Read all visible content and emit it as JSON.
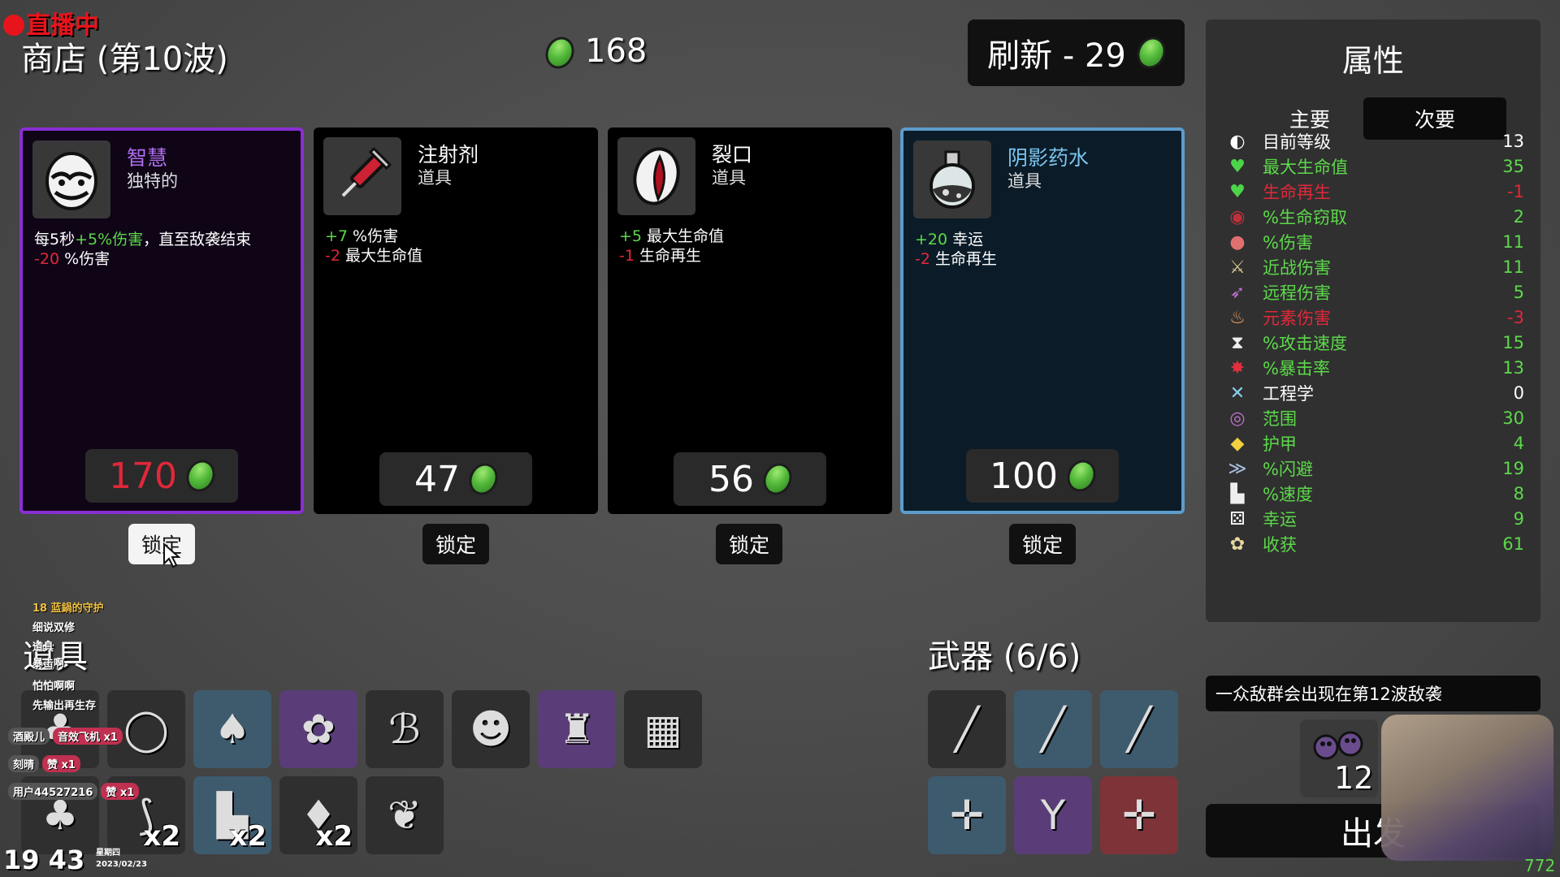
{
  "overlay": {
    "live_label": "直播中"
  },
  "header": {
    "title": "商店 (第10波)",
    "gold": "168",
    "reroll_label": "刷新 - 29"
  },
  "cards": [
    {
      "name": "智慧",
      "type": "独特的",
      "price": "170",
      "lock": "锁定",
      "effects": [
        [
          {
            "t": "每5秒",
            "c": "w"
          },
          {
            "t": "+5%伤害",
            "c": "pos"
          },
          {
            "t": "，直至敌袭结束",
            "c": "w"
          }
        ],
        [
          {
            "t": "-20",
            "c": "neg"
          },
          {
            "t": " %伤害",
            "c": "w"
          }
        ]
      ]
    },
    {
      "name": "注射剂",
      "type": "道具",
      "price": "47",
      "lock": "锁定",
      "effects": [
        [
          {
            "t": "+7",
            "c": "pos"
          },
          {
            "t": " %伤害",
            "c": "w"
          }
        ],
        [
          {
            "t": "-2",
            "c": "neg"
          },
          {
            "t": " 最大生命值",
            "c": "w"
          }
        ]
      ]
    },
    {
      "name": "裂口",
      "type": "道具",
      "price": "56",
      "lock": "锁定",
      "effects": [
        [
          {
            "t": "+5",
            "c": "pos"
          },
          {
            "t": " 最大生命值",
            "c": "w"
          }
        ],
        [
          {
            "t": "-1",
            "c": "neg"
          },
          {
            "t": " 生命再生",
            "c": "w"
          }
        ]
      ]
    },
    {
      "name": "阴影药水",
      "type": "道具",
      "price": "100",
      "lock": "锁定",
      "effects": [
        [
          {
            "t": "+20",
            "c": "pos"
          },
          {
            "t": " 幸运",
            "c": "w"
          }
        ],
        [
          {
            "t": "-2",
            "c": "neg"
          },
          {
            "t": " 生命再生",
            "c": "w"
          }
        ]
      ]
    }
  ],
  "stats": {
    "title": "属性",
    "tab_main": "主要",
    "tab_secondary": "次要",
    "rows": [
      {
        "label": "目前等级",
        "value": "13",
        "c": "w",
        "icon": "level-up-icon"
      },
      {
        "label": "最大生命值",
        "value": "35",
        "c": "g",
        "icon": "heart-icon"
      },
      {
        "label": "生命再生",
        "value": "-1",
        "c": "r",
        "icon": "heart-plus-icon"
      },
      {
        "label": "%生命窃取",
        "value": "2",
        "c": "g",
        "icon": "teeth-icon"
      },
      {
        "label": "%伤害",
        "value": "11",
        "c": "g",
        "icon": "muscle-icon"
      },
      {
        "label": "近战伤害",
        "value": "11",
        "c": "g",
        "icon": "sword-icon"
      },
      {
        "label": "远程伤害",
        "value": "5",
        "c": "g",
        "icon": "bow-icon"
      },
      {
        "label": "元素伤害",
        "value": "-3",
        "c": "r",
        "icon": "flame-icon"
      },
      {
        "label": "%攻击速度",
        "value": "15",
        "c": "g",
        "icon": "hourglass-icon"
      },
      {
        "label": "%暴击率",
        "value": "13",
        "c": "g",
        "icon": "crit-burst-icon"
      },
      {
        "label": "工程学",
        "value": "0",
        "c": "w",
        "icon": "wrench-cross-icon"
      },
      {
        "label": "范围",
        "value": "30",
        "c": "g",
        "icon": "range-icon"
      },
      {
        "label": "护甲",
        "value": "4",
        "c": "g",
        "icon": "shield-icon"
      },
      {
        "label": "%闪避",
        "value": "19",
        "c": "g",
        "icon": "dodge-icon"
      },
      {
        "label": "%速度",
        "value": "8",
        "c": "g",
        "icon": "boot-icon"
      },
      {
        "label": "幸运",
        "value": "9",
        "c": "g",
        "icon": "dice-icon"
      },
      {
        "label": "收获",
        "value": "61",
        "c": "g",
        "icon": "wheat-icon"
      }
    ]
  },
  "inventory": {
    "items_heading": "道具",
    "weapons_heading": "武器 (6/6)",
    "items": [
      {
        "icon": "tree-icon",
        "bg": "",
        "count": ""
      },
      {
        "icon": "egg-mask-icon",
        "bg": "",
        "count": ""
      },
      {
        "icon": "garden-bed-icon",
        "bg": "blu",
        "count": ""
      },
      {
        "icon": "wheat-icon",
        "bg": "pur",
        "count": ""
      },
      {
        "icon": "butterfly-icon",
        "bg": "",
        "count": ""
      },
      {
        "icon": "scarecrow-face-icon",
        "bg": "",
        "count": ""
      },
      {
        "icon": "fire-extinguisher-icon",
        "bg": "pur",
        "count": ""
      },
      {
        "icon": "flannel-shirt-icon",
        "bg": "",
        "count": ""
      },
      {
        "icon": "tree-icon",
        "bg": "",
        "count": ""
      },
      {
        "icon": "crooked-stick-icon",
        "bg": "",
        "count": "x2"
      },
      {
        "icon": "boot-icon",
        "bg": "blu",
        "count": "x2"
      },
      {
        "icon": "seed-bag-icon",
        "bg": "",
        "count": "x2"
      },
      {
        "icon": "fertilizer-bag-icon",
        "bg": "",
        "count": ""
      }
    ],
    "weapons": [
      {
        "icon": "spear-icon",
        "bg": ""
      },
      {
        "icon": "spear-icon",
        "bg": "blu"
      },
      {
        "icon": "spear-icon",
        "bg": "blu"
      },
      {
        "icon": "crossbow-icon",
        "bg": "blu"
      },
      {
        "icon": "slingshot-icon",
        "bg": "pur"
      },
      {
        "icon": "crossbow-icon",
        "bg": "red"
      }
    ]
  },
  "wave": {
    "notice": "一众敌群会出现在第12波敌袭",
    "enemy_count": "12",
    "go_label": "出发"
  },
  "chat": [
    {
      "user": "18 蓝鍋的守护",
      "text": ""
    },
    {
      "user": "细说双修",
      "text": ""
    },
    {
      "user": "道具",
      "text": ""
    },
    {
      "user": "暴击啊",
      "text": ""
    },
    {
      "user": "怕怕啊啊",
      "text": ""
    },
    {
      "user": "先输出再生存",
      "text": ""
    },
    {
      "user": "酒殿儿",
      "text": "音效飞机 x1"
    },
    {
      "user": "刻晴",
      "text": "赞 x1"
    },
    {
      "user": "用户44527216",
      "text": "赞 x1"
    }
  ],
  "clock": {
    "time": "19 43",
    "weekday": "星期四",
    "date": "2023/02/23"
  },
  "corner_number": "772"
}
